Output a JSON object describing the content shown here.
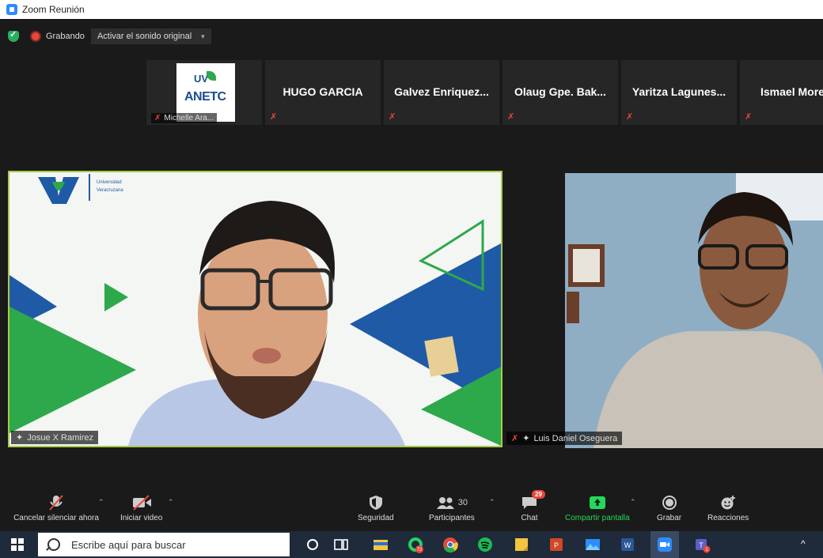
{
  "window": {
    "title": "Zoom Reunión"
  },
  "topbar": {
    "recording": "Grabando",
    "original_sound": "Activar el sonido original"
  },
  "gallery": [
    {
      "name": "Michelle Ara...",
      "type": "logo"
    },
    {
      "name": "HUGO GARCIA"
    },
    {
      "name": "Galvez Enriquez..."
    },
    {
      "name": "Olaug Gpe. Bak..."
    },
    {
      "name": "Yaritza Lagunes..."
    },
    {
      "name": "Ismael More"
    }
  ],
  "logo": {
    "uv": "UV",
    "anetc": "ANETC"
  },
  "main_video": {
    "name": "Josue X Ramirez",
    "institution_lines": [
      "Universidad",
      "Veracruzana"
    ]
  },
  "side_video": {
    "name": "Luis Daniel Oseguera"
  },
  "toolbar": {
    "mute": "Cancelar silenciar ahora",
    "video": "Iniciar video",
    "security": "Seguridad",
    "participants": "Participantes",
    "participants_count": "30",
    "chat": "Chat",
    "chat_badge": "29",
    "share": "Compartir pantalla",
    "record": "Grabar",
    "reactions": "Reacciones"
  },
  "taskbar": {
    "search_placeholder": "Escribe aquí para buscar",
    "whatsapp_badge": "72",
    "teams_badge": "1"
  },
  "colors": {
    "zoom_blue": "#2d8cff",
    "share_green": "#23d959",
    "active_border": "#a8c94b",
    "rec_red": "#e8463a"
  }
}
